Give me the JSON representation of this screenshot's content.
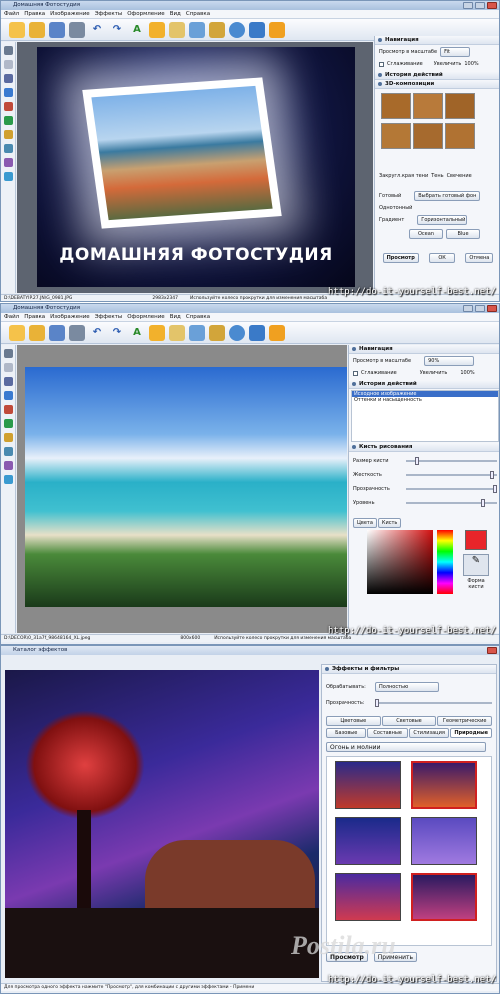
{
  "s1": {
    "title": "Домашняя Фотостудия",
    "menu": [
      "Файл",
      "Правка",
      "Изображение",
      "Эффекты",
      "Оформление",
      "Вид",
      "Справка"
    ],
    "caption": "ДОМАШНЯЯ ФОТОСТУДИЯ",
    "nav_header": "Навигация",
    "zoom_label": "Просмотр в масштабе",
    "zoom_value": "Fit",
    "smooth": "Сглаживание",
    "enlarge": "Увеличить",
    "percent": "100%",
    "history_header": "История действий",
    "comp_header": "3D-композиции",
    "chk_shadow": "Закругл.края тени",
    "chk_shade": "Тень",
    "chk_glow": "Свечение",
    "opt_ready": "Готовый",
    "opt_select": "Выбрать готовый фон",
    "opt_texture": "Однотонный",
    "opt_gradient": "Градиент",
    "opt_horiz": "Горизонтальный",
    "c1": "Ocean",
    "c2": "Blue",
    "btn_preview": "Просмотр",
    "btn_ok": "ОК",
    "btn_cancel": "Отмена",
    "status_path": "D:\\DEBATYIP.27.JN\\G_0981.JPG",
    "status_size": "2983x2347",
    "status_hint": "Используйте колесо прокрутки для изменения масштаба"
  },
  "s2": {
    "title": "Домашняя Фотостудия",
    "menu": [
      "Файл",
      "Правка",
      "Изображение",
      "Эффекты",
      "Оформление",
      "Вид",
      "Справка"
    ],
    "nav_header": "Навигация",
    "zoom_label": "Просмотр в масштабе",
    "zoom_value": "90%",
    "smooth": "Сглаживание",
    "enlarge": "Увеличить",
    "percent": "100%",
    "history_header": "История действий",
    "history_items": [
      "Исходное изображение",
      "Оттенки и насыщенность"
    ],
    "brush_header": "Кисть рисования",
    "brush_size": "Размер кисти",
    "brush_hard": "Жесткость",
    "brush_opacity": "Прозрачность",
    "brush_level": "Уровень",
    "tab_color": "Цвета",
    "tab_brush": "Кисть",
    "shape_label": "Форма кисти",
    "status_path": "D:\\DECOR\\0_31a7f_98648164_XL.jpeg",
    "status_size": "800x600",
    "status_hint": "Используйте колесо прокрутки для изменения масштаба"
  },
  "s3": {
    "title": "Каталог эффектов",
    "panel_header": "Эффекты и фильтры",
    "apply_label": "Обрабатывать:",
    "apply_value": "Полностью",
    "transp_label": "Прозрачность:",
    "tabs_row1": [
      "Цветовые",
      "Световые",
      "Геометрические"
    ],
    "tabs_row2": [
      "Базовые",
      "Составные",
      "Стилизация",
      "Природные"
    ],
    "category": "Огонь и молнии",
    "btn_preview": "Просмотр",
    "btn_apply": "Применить",
    "status_hint": "Для просмотра одного эффекта нажмите \"Просмотр\", для комбинации с другими эффектами - Примени"
  },
  "watermark": "http://do-it-yourself-best.net/",
  "logo": "Postila.ru"
}
